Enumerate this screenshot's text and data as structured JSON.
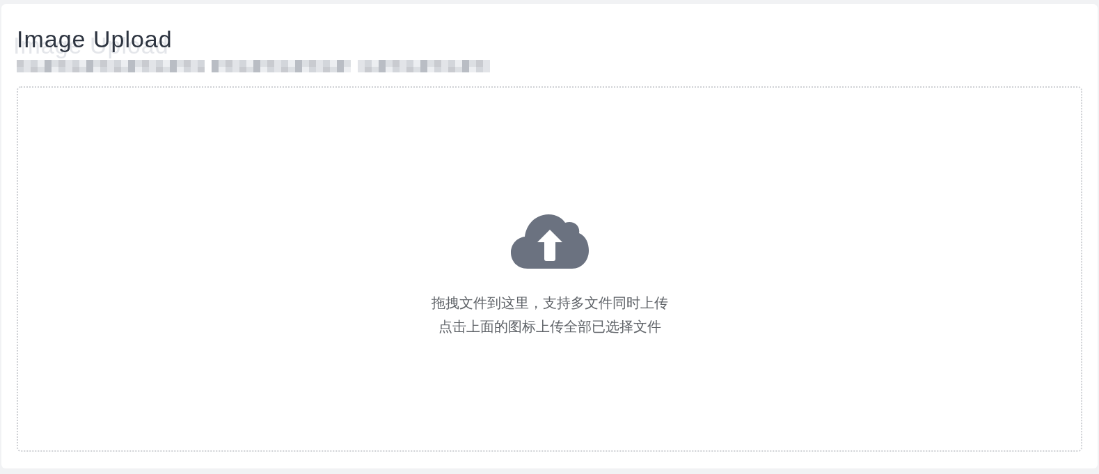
{
  "card": {
    "title": "Image Upload"
  },
  "dropzone": {
    "lines": [
      "拖拽文件到这里，支持多文件同时上传",
      "点击上面的图标上传全部已选择文件"
    ]
  }
}
